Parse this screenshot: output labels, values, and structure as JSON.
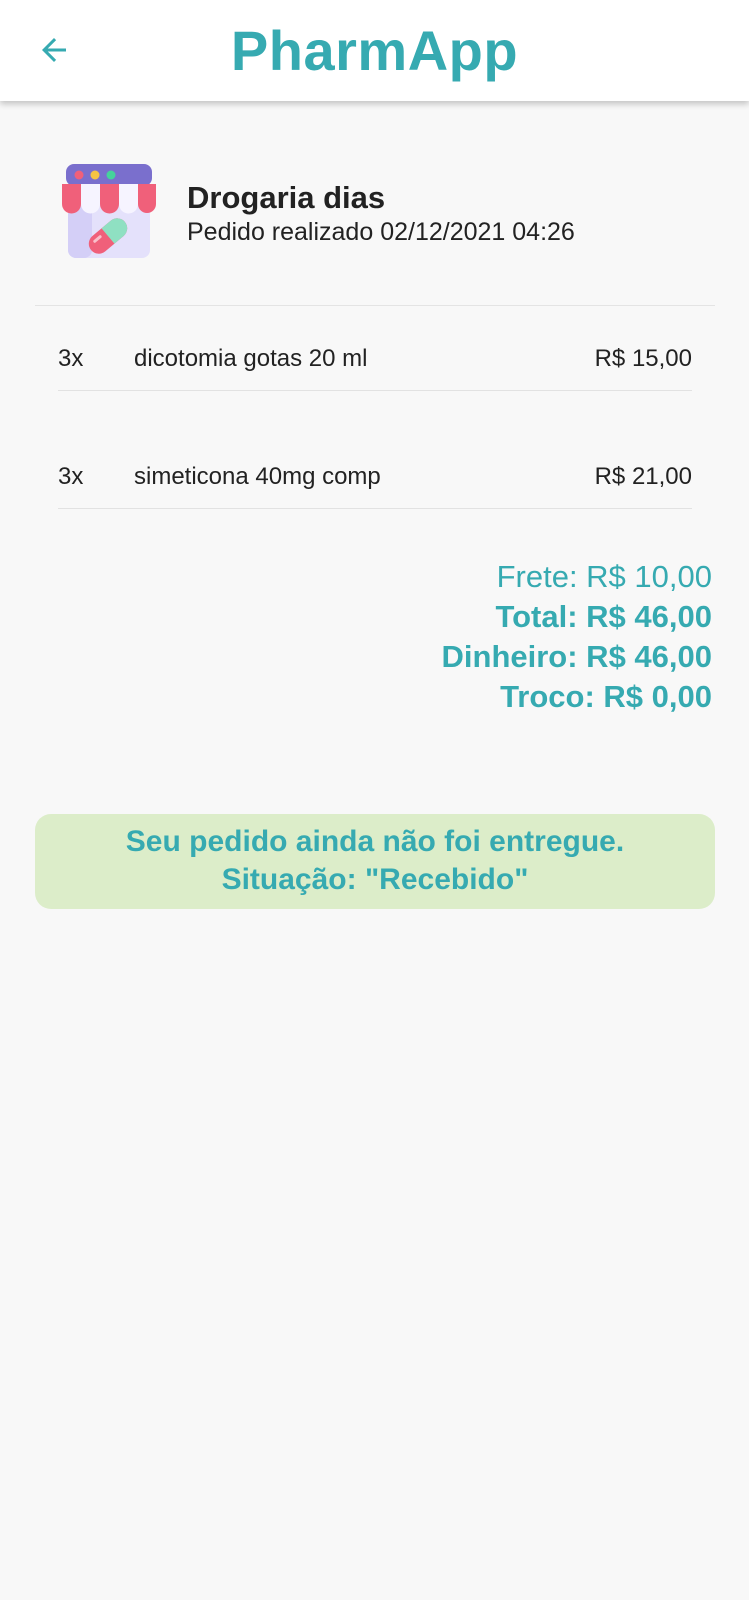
{
  "app": {
    "title": "PharmApp",
    "accent_color": "#36aab1",
    "back_icon": "arrow-left-icon"
  },
  "store": {
    "name": "Drogaria dias",
    "order_info": "Pedido realizado 02/12/2021 04:26",
    "icon": "pharmacy-store-icon"
  },
  "items": [
    {
      "qty": "3x",
      "name": "dicotomia gotas 20 ml",
      "price": "R$ 15,00"
    },
    {
      "qty": "3x",
      "name": "simeticona 40mg comp",
      "price": "R$ 21,00"
    }
  ],
  "summary": {
    "frete": "Frete: R$ 10,00",
    "total": "Total: R$ 46,00",
    "dinheiro": "Dinheiro: R$ 46,00",
    "troco": "Troco: R$ 0,00"
  },
  "status": {
    "line1": "Seu pedido ainda não foi entregue.",
    "line2": "Situação: \"Recebido\"",
    "background": "#dcedc9"
  }
}
